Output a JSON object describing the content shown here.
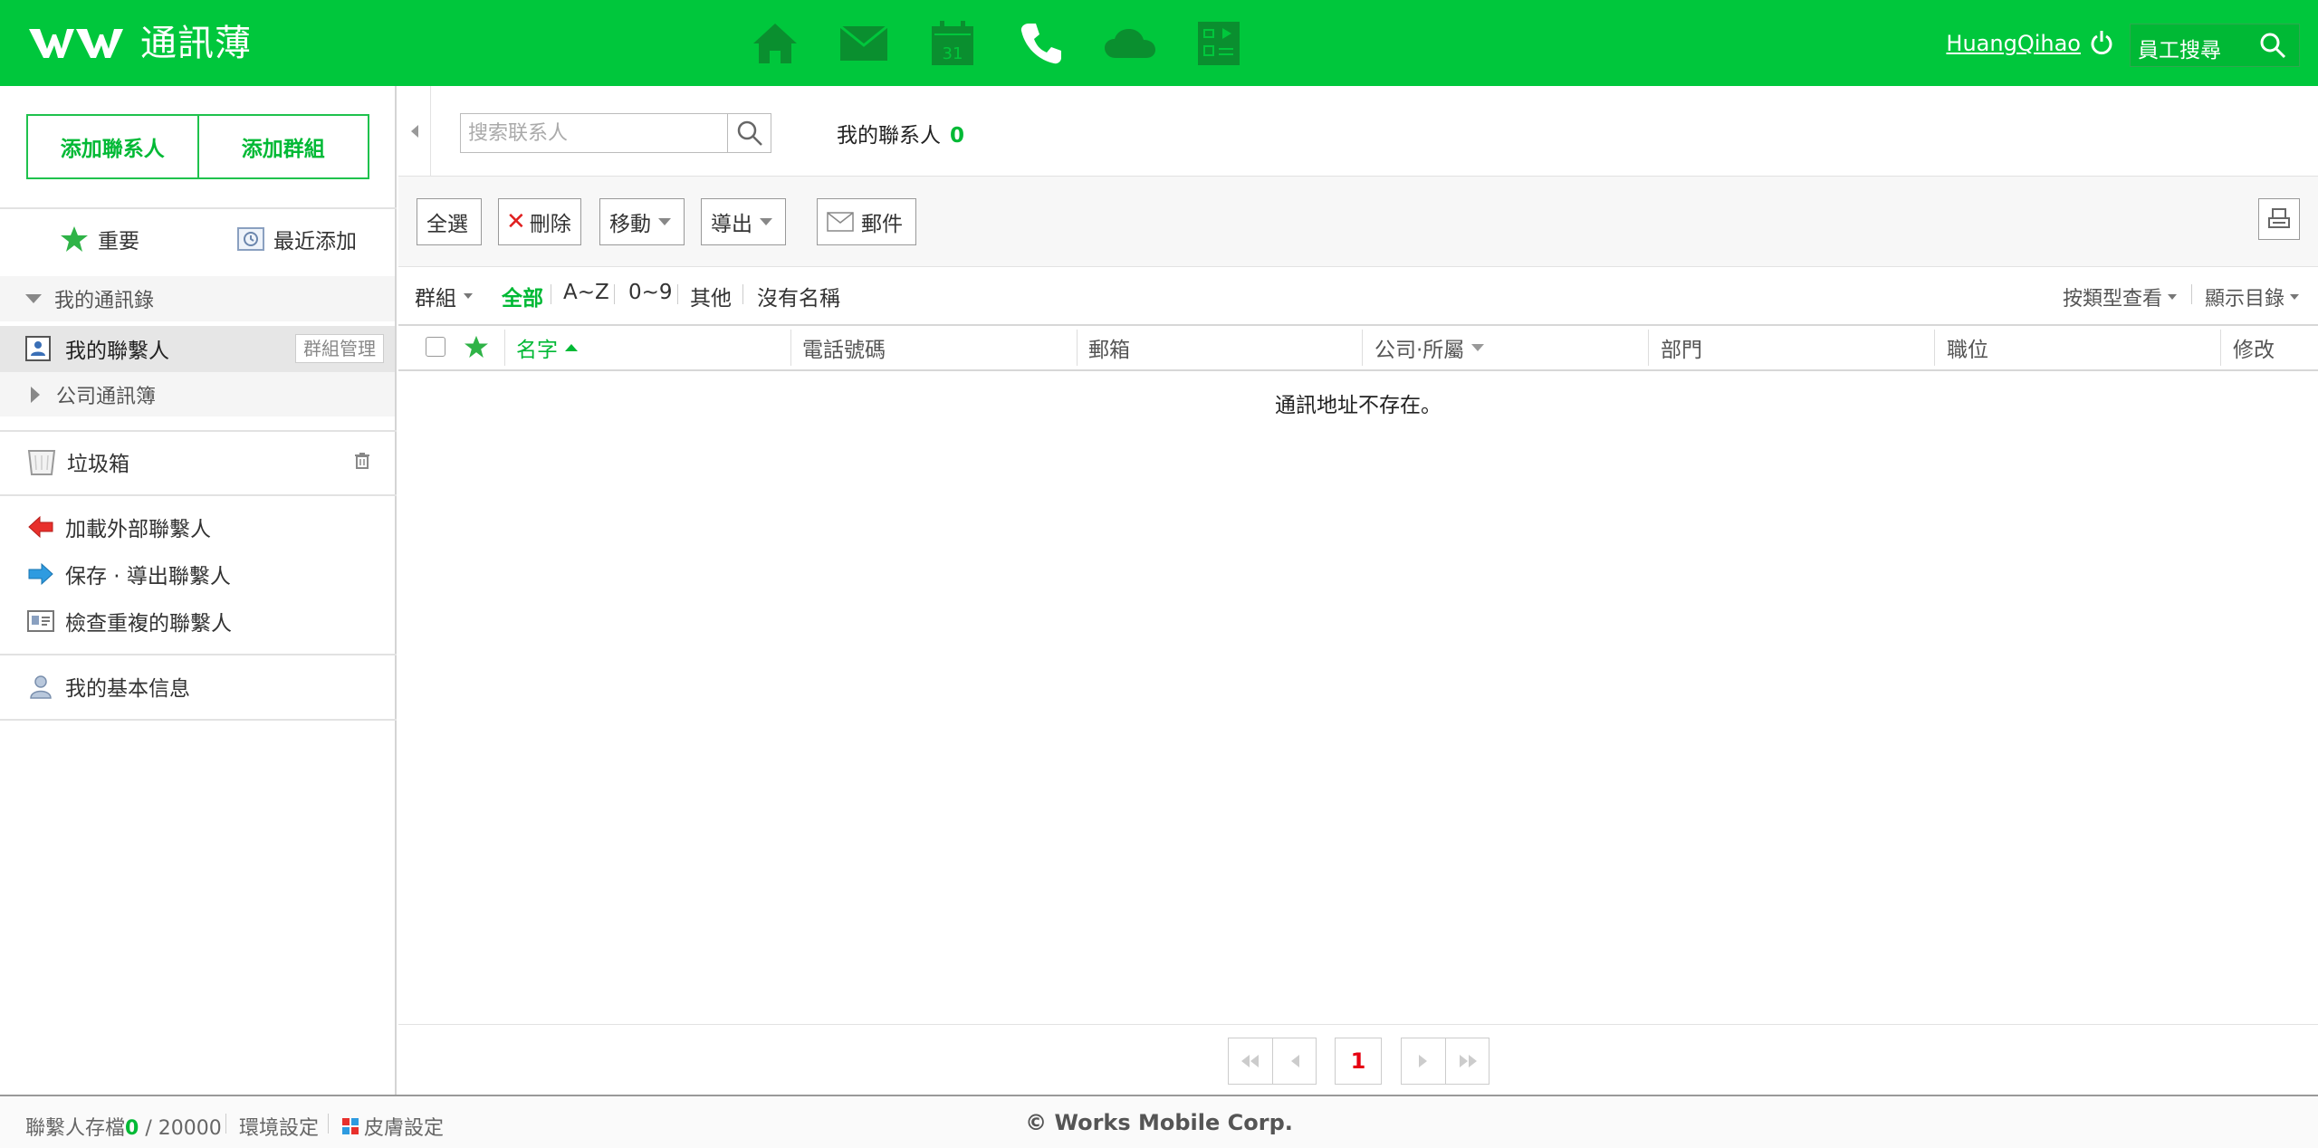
{
  "header": {
    "app_title": "通訊薄",
    "username": "HuangQihao",
    "employee_search": "員工搜尋",
    "calendar_day": "31"
  },
  "sidebar": {
    "add_contact": "添加聯系人",
    "add_group": "添加群組",
    "important": "重要",
    "recent": "最近添加",
    "my_address_book": "我的通訊錄",
    "my_contacts": "我的聯繫人",
    "group_manage": "群組管理",
    "company_book": "公司通訊簿",
    "trash": "垃圾箱",
    "import_external": "加載外部聯繫人",
    "save_export": "保存 · 導出聯繫人",
    "check_duplicates": "檢查重複的聯繫人",
    "my_info": "我的基本信息"
  },
  "main": {
    "search_placeholder": "搜索联系人",
    "title": "我的聯系人",
    "count": "0",
    "toolbar": {
      "select_all": "全選",
      "delete": "刪除",
      "move": "移動",
      "export": "導出",
      "mail": "郵件"
    },
    "filters": {
      "group": "群組",
      "all": "全部",
      "az": "A~Z",
      "num": "0~9",
      "other": "其他",
      "no_name": "沒有名稱",
      "view_by_type": "按類型查看",
      "show_columns": "顯示目錄"
    },
    "columns": {
      "name": "名字",
      "phone": "電話號碼",
      "email": "郵箱",
      "company": "公司·所屬",
      "department": "部門",
      "position": "職位",
      "edit": "修改"
    },
    "empty_message": "通訊地址不存在。",
    "current_page": "1"
  },
  "footer": {
    "storage_label": "聯繫人存檔",
    "storage_used": "0",
    "storage_total": "20000",
    "env_settings": "環境設定",
    "skin_settings": "皮膚設定",
    "copyright": "© Works Mobile Corp."
  },
  "colors": {
    "brand_green": "#00c73c",
    "accent_green": "#00b935",
    "page_red": "#e60012"
  }
}
